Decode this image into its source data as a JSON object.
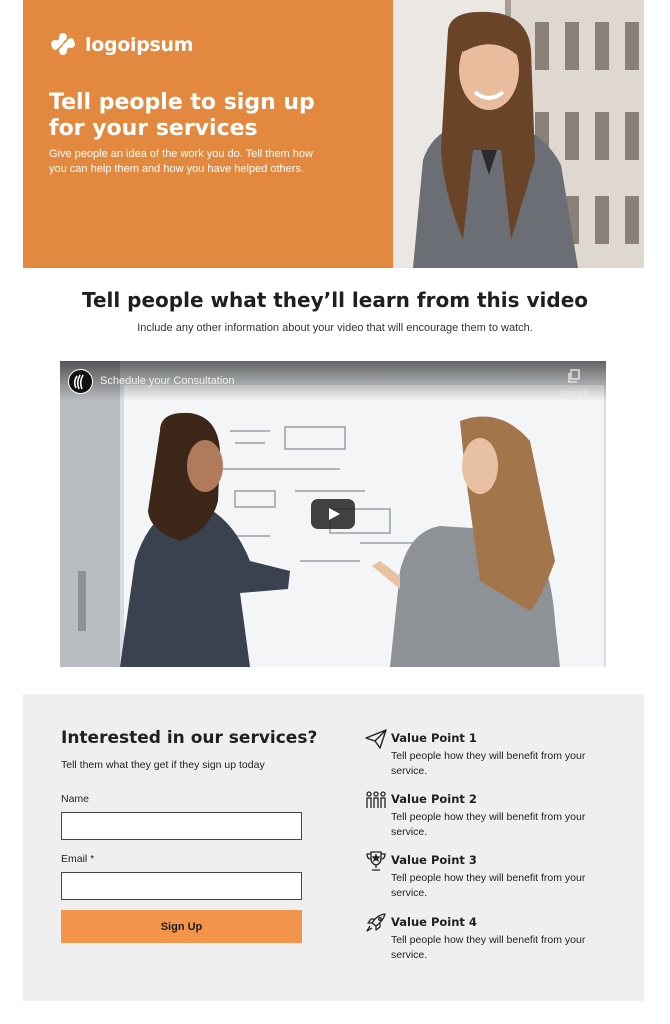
{
  "hero": {
    "logo_text": "logoipsum",
    "title_line1": "Tell people to sign up",
    "title_line2": "for your services",
    "description": "Give people an idea of the work you do. Tell them how you can help them and how you have helped others."
  },
  "video_section": {
    "title": "Tell people what they’ll learn from this video",
    "subtitle": "Include any other information about your video that will encourage them to watch.",
    "video_title": "Schedule your Consultation",
    "copy_label": "Copy link"
  },
  "form": {
    "title": "Interested in our services?",
    "subtitle": "Tell them what they get if they sign up today",
    "name_label": "Name",
    "name_value": "",
    "email_label": "Email *",
    "email_value": "",
    "button_label": "Sign Up"
  },
  "value_points": [
    {
      "title": "Value Point 1",
      "desc": "Tell people how they will benefit from your service.",
      "icon": "paper-plane-icon"
    },
    {
      "title": "Value Point 2",
      "desc": "Tell people how they will benefit from your service.",
      "icon": "people-group-icon"
    },
    {
      "title": "Value Point 3",
      "desc": "Tell people how they will benefit from your service.",
      "icon": "trophy-icon"
    },
    {
      "title": "Value Point 4",
      "desc": "Tell people how they will benefit from your service.",
      "icon": "rocket-icon"
    }
  ],
  "colors": {
    "hero_bg": "#E2893F",
    "button_bg": "#F2954A",
    "form_bg": "#EFEFEF"
  }
}
